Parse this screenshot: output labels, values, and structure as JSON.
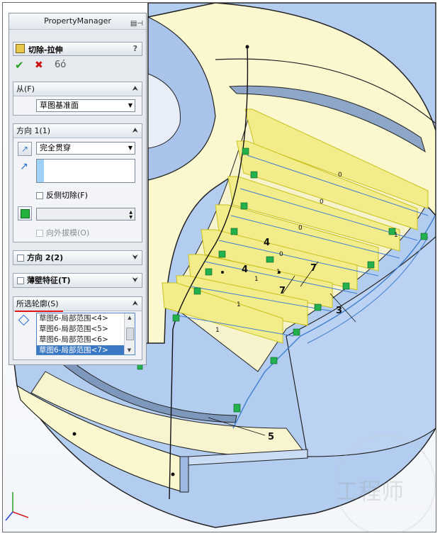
{
  "property_manager": {
    "title": "PropertyManager",
    "feature": {
      "name": "切除-拉伸",
      "help": "?"
    },
    "actions": {
      "ok": "✔",
      "cancel": "✖",
      "preview": "6ó"
    },
    "from_section": {
      "label": "从(F)",
      "value": "草图基准面"
    },
    "direction1": {
      "label": "方向 1(1)",
      "end_condition": "完全贯穿",
      "direction_value": "",
      "flip_side_label": "反侧切除(F)",
      "draft_value": "",
      "draft_outward_label": "向外拔模(O)"
    },
    "direction2": {
      "label": "方向 2(2)"
    },
    "thin_feature": {
      "label": "薄壁特征(T)"
    },
    "selected_contours": {
      "label": "所选轮廓(S)",
      "items": [
        "草图6-局部范围<4>",
        "草图6-局部范围<5>",
        "草图6-局部范围<6>",
        "草图6-局部范围<7>"
      ]
    }
  },
  "viewport": {
    "dimensions": [
      "4",
      "4",
      "7",
      "7",
      "3",
      "5"
    ],
    "relation_labels": [
      "0",
      "0",
      "0",
      "0",
      "1",
      "1",
      "1",
      "1",
      "1"
    ],
    "watermark": "工程师",
    "colors": {
      "face_yellow": "#fbf7cf",
      "body_blue": "#b3cdf1",
      "highlight": "#f5ee6c",
      "relation_green": "#22b14c",
      "sketch_blue": "#3f7fd0"
    }
  }
}
